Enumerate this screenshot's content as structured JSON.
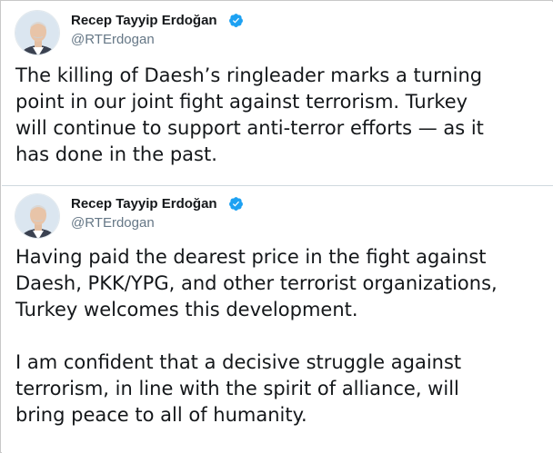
{
  "tweets": [
    {
      "author_name": "Recep Tayyip Erdoğan",
      "author_handle": "@RTErdogan",
      "text": "The killing of Daesh’s ringleader marks a turning\npoint in our joint fight against terrorism. Turkey\nwill continue to support anti-terror efforts — as it\nhas done in the past."
    },
    {
      "author_name": "Recep Tayyip Erdoğan",
      "author_handle": "@RTErdogan",
      "text": "Having paid the dearest price in the fight against\nDaesh, PKK/YPG, and other terrorist organizations,\nTurkey welcomes this development.\n\nI am confident that a decisive struggle against\nterrorism, in line with the spirit of alliance, will\nbring peace to all of humanity."
    }
  ],
  "colors": {
    "verified_badge": "#1da1f2",
    "name_text": "#14171a",
    "handle_text": "#657786"
  },
  "icons": {
    "verified": "verified-badge-icon",
    "avatar": "profile-avatar"
  }
}
